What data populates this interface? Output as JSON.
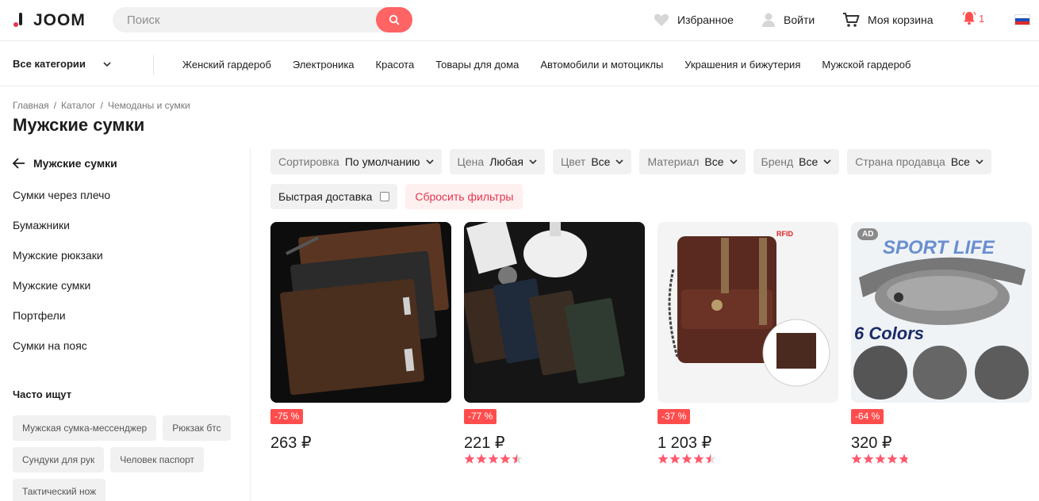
{
  "header": {
    "logo_text": "JOOM",
    "search_placeholder": "Поиск",
    "favorites": "Избранное",
    "login": "Войти",
    "cart": "Моя корзина",
    "notifications_count": "1"
  },
  "catbar": {
    "all_categories": "Все категории",
    "links": [
      "Женский гардероб",
      "Электроника",
      "Красота",
      "Товары для дома",
      "Автомобили и мотоциклы",
      "Украшения и бижутерия",
      "Мужской гардероб"
    ]
  },
  "breadcrumb": [
    "Главная",
    "/",
    "Каталог",
    "/",
    "Чемоданы и сумки"
  ],
  "page_title": "Мужские сумки",
  "sidebar": {
    "back_label": "Мужские сумки",
    "subcategories": [
      "Сумки через плечо",
      "Бумажники",
      "Мужские рюкзаки",
      "Мужские сумки",
      "Портфели",
      "Сумки на пояс"
    ],
    "frequent_title": "Часто ищут",
    "chips": [
      "Мужская сумка-мессенджер",
      "Рюкзак бтс",
      "Сундуки для рук",
      "Человек паспорт",
      "Тактический нож"
    ]
  },
  "filters": [
    {
      "label": "Сортировка",
      "value": "По умолчанию"
    },
    {
      "label": "Цена",
      "value": "Любая"
    },
    {
      "label": "Цвет",
      "value": "Все"
    },
    {
      "label": "Материал",
      "value": "Все"
    },
    {
      "label": "Бренд",
      "value": "Все"
    },
    {
      "label": "Страна продавца",
      "value": "Все"
    }
  ],
  "fast_delivery": "Быстрая доставка",
  "reset_filters": "Сбросить фильтры",
  "products": [
    {
      "discount": "-75 %",
      "price": "263 ₽",
      "rating": null
    },
    {
      "discount": "-77 %",
      "price": "221 ₽",
      "rating": 4.5
    },
    {
      "discount": "-37 %",
      "price": "1 203 ₽",
      "rating": 4.5
    },
    {
      "discount": "-64 %",
      "price": "320 ₽",
      "rating": 4.8,
      "ad_badge": "AD",
      "image_text_1": "SPORT LIFE",
      "image_text_2": "6 Colors"
    }
  ],
  "product_image_labels": {
    "rfid": "RFID"
  },
  "colors": {
    "accent": "#ff6464",
    "discount": "#ff4d4d",
    "star": "#ff5a6e"
  }
}
